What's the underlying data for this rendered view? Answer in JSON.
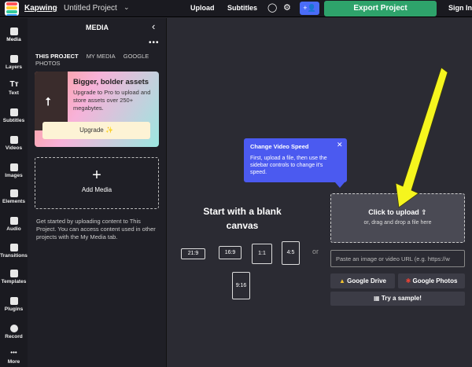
{
  "topbar": {
    "brand": "Kapwing",
    "project_title": "Untitled Project",
    "upload": "Upload",
    "subtitles": "Subtitles",
    "export": "Export Project",
    "signin": "Sign In"
  },
  "rail": {
    "items": [
      {
        "label": "Media",
        "icon": "media-icon"
      },
      {
        "label": "Layers",
        "icon": "layers-icon"
      },
      {
        "label": "Text",
        "icon": "text-icon"
      },
      {
        "label": "Subtitles",
        "icon": "subtitles-icon"
      },
      {
        "label": "Videos",
        "icon": "videos-icon"
      },
      {
        "label": "Images",
        "icon": "images-icon"
      },
      {
        "label": "Elements",
        "icon": "elements-icon"
      },
      {
        "label": "Audio",
        "icon": "audio-icon"
      },
      {
        "label": "Transitions",
        "icon": "transitions-icon"
      },
      {
        "label": "Templates",
        "icon": "templates-icon"
      },
      {
        "label": "Plugins",
        "icon": "plugins-icon"
      },
      {
        "label": "Record",
        "icon": "record-icon"
      },
      {
        "label": "More",
        "icon": "more-icon"
      }
    ]
  },
  "panel": {
    "title": "MEDIA",
    "tabs": [
      "THIS PROJECT",
      "MY MEDIA",
      "GOOGLE PHOTOS"
    ],
    "promo_title": "Bigger, bolder assets",
    "promo_text": "Upgrade to Pro to upload and store assets over 250+ megabytes.",
    "promo_button": "Upgrade ✨",
    "add_media": "Add Media",
    "note": "Get started by uploading content to This Project. You can access content used in other projects with the My Media tab."
  },
  "tooltip": {
    "title": "Change Video Speed",
    "text": "First, upload a file, then use the sidebar controls to change it's speed."
  },
  "canvas": {
    "blank_title": "Start with a blank canvas",
    "ratios": [
      "21:9",
      "16:9",
      "1:1",
      "4:5",
      "9:16"
    ],
    "or": "or",
    "click_to_upload": "Click to upload",
    "drag_drop": "or, drag and drop a file here",
    "url_placeholder": "Paste an image or video URL (e.g. https://w",
    "google_drive": "Google Drive",
    "google_photos": "Google Photos",
    "try_sample": "Try a sample!"
  },
  "colors": {
    "export_green": "#2ea36b",
    "tooltip_blue": "#4b5af0",
    "arrow_yellow": "#f5f51e"
  }
}
